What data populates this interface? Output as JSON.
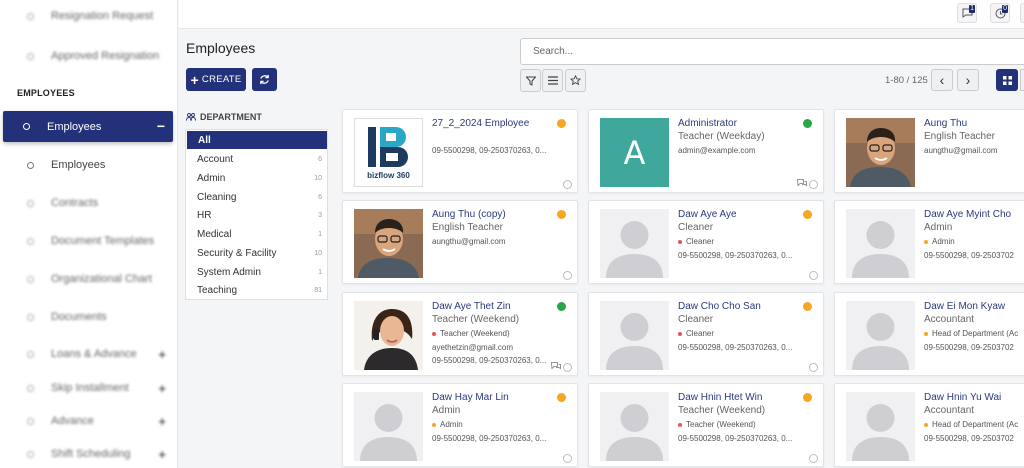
{
  "sidebar": {
    "items_top": [
      {
        "label": "Resignation Request"
      },
      {
        "label": "Approved Resignation"
      }
    ],
    "section": "EMPLOYEES",
    "active": {
      "label": "Employees",
      "toggle": "−"
    },
    "items": [
      {
        "label": "Employees"
      },
      {
        "label": "Contracts"
      },
      {
        "label": "Document Templates"
      },
      {
        "label": "Organizational Chart"
      },
      {
        "label": "Documents"
      },
      {
        "label": "Loans & Advance"
      },
      {
        "label": "Skip Installment"
      },
      {
        "label": "Advance"
      },
      {
        "label": "Shift Scheduling"
      }
    ]
  },
  "topbar": {
    "messages_badge": "1",
    "activity_badge": "0"
  },
  "header": {
    "title": "Employees",
    "search_placeholder": "Search...",
    "create_label": "CREATE",
    "pager": "1-80 / 125"
  },
  "department": {
    "title": "DEPARTMENT",
    "items": [
      {
        "label": "All",
        "count": ""
      },
      {
        "label": "Account",
        "count": "6"
      },
      {
        "label": "Admin",
        "count": "10"
      },
      {
        "label": "Cleaning",
        "count": "6"
      },
      {
        "label": "HR",
        "count": "3"
      },
      {
        "label": "Medical",
        "count": "1"
      },
      {
        "label": "Security & Facility",
        "count": "10"
      },
      {
        "label": "System Admin",
        "count": "1"
      },
      {
        "label": "Teaching",
        "count": "81"
      }
    ]
  },
  "colors": {
    "primary": "#23317a",
    "status_orange": "#f5a623",
    "status_green": "#27a844",
    "tag_red": "#e05a4f",
    "tag_orange": "#f5a623"
  },
  "cards": [
    {
      "name": "27_2_2024 Employee",
      "title": "",
      "tag": "",
      "line4": "",
      "line3_text": "09-5500298, 09-250370263, 0...",
      "status": "orange",
      "photo": "logo",
      "logo_text": "bizflow 360"
    },
    {
      "name": "Administrator",
      "title": "Teacher (Weekday)",
      "tag": "",
      "line3_text": "admin@example.com",
      "line4": "",
      "status": "green",
      "photo": "letter",
      "letter": "A",
      "chat": true
    },
    {
      "name": "Aung Thu",
      "title": "English Teacher",
      "tag": "",
      "line3_text": "aungthu@gmail.com",
      "line4": "",
      "status": "",
      "photo": "man"
    },
    {
      "name": "Aung Thu (copy)",
      "title": "English Teacher",
      "tag": "",
      "line3_text": "aungthu@gmail.com",
      "line4": "",
      "status": "orange",
      "photo": "man"
    },
    {
      "name": "Daw Aye Aye",
      "title": "Cleaner",
      "tag": "Cleaner",
      "tag_color": "red",
      "line3_text": "",
      "line4": "09-5500298, 09-250370263, 0...",
      "status": "orange",
      "photo": "placeholder"
    },
    {
      "name": "Daw Aye Myint Cho",
      "title": "Admin",
      "tag": "Admin",
      "tag_color": "orange",
      "line3_text": "",
      "line4": "09-5500298, 09-2503702",
      "status": "",
      "photo": "placeholder"
    },
    {
      "name": "Daw Aye Thet Zin",
      "title": "Teacher (Weekend)",
      "tag": "Teacher (Weekend)",
      "tag_color": "red",
      "line3_text": "",
      "line4": "ayethetzin@gmail.com",
      "line5": "09-5500298, 09-250370263, 0...",
      "status": "green",
      "photo": "woman",
      "chat": true
    },
    {
      "name": "Daw Cho Cho San",
      "title": "Cleaner",
      "tag": "Cleaner",
      "tag_color": "red",
      "line3_text": "",
      "line4": "09-5500298, 09-250370263, 0...",
      "status": "orange",
      "photo": "placeholder"
    },
    {
      "name": "Daw Ei Mon Kyaw",
      "title": "Accountant",
      "tag": "Head of Department (Ac",
      "tag_color": "orange",
      "line3_text": "",
      "line4": "09-5500298, 09-2503702",
      "status": "",
      "photo": "placeholder"
    },
    {
      "name": "Daw Hay Mar Lin",
      "title": "Admin",
      "tag": "Admin",
      "tag_color": "orange",
      "line3_text": "",
      "line4": "09-5500298, 09-250370263, 0...",
      "status": "orange",
      "photo": "placeholder"
    },
    {
      "name": "Daw Hnin Htet Win",
      "title": "Teacher (Weekend)",
      "tag": "Teacher (Weekend)",
      "tag_color": "red",
      "line3_text": "",
      "line4": "09-5500298, 09-250370263, 0...",
      "status": "orange",
      "photo": "placeholder"
    },
    {
      "name": "Daw Hnin Yu Wai",
      "title": "Accountant",
      "tag": "Head of Department (Ac",
      "tag_color": "orange",
      "line3_text": "",
      "line4": "09-5500298, 09-2503702",
      "status": "",
      "photo": "placeholder"
    }
  ]
}
